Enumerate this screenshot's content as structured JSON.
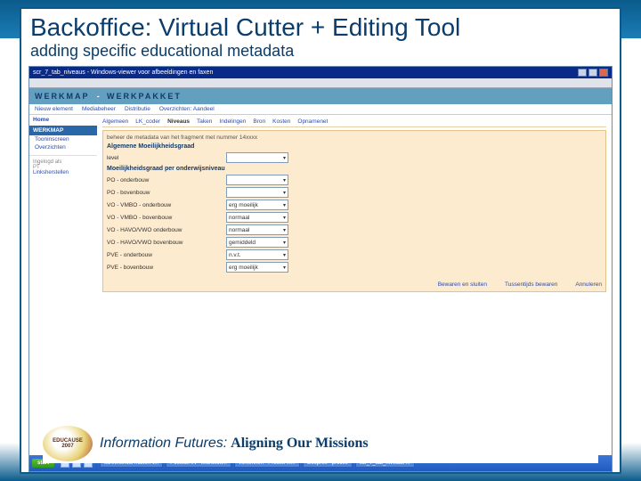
{
  "slide": {
    "title": "Backoffice: Virtual Cutter + Editing Tool",
    "subtitle": "adding specific educational metadata"
  },
  "window": {
    "title": "scr_7_tab_niveaus - Windows-viewer voor afbeeldingen en faxen"
  },
  "app": {
    "header1": "WERKMAP",
    "sep": "-",
    "header2": "WERKPAKKET",
    "topnav": [
      "Nieuw element",
      "Mediabeheer",
      "Distributie",
      "Overzichten: Aandeel"
    ]
  },
  "sidebar": {
    "home": "Home",
    "section": "WERKMAP",
    "links": [
      "Tooninscreen",
      "Overzichten"
    ],
    "logged_label": "Ingelogd als",
    "logged_user": "PT",
    "links2": "Linksherstellen"
  },
  "tabs": [
    "Algemeen",
    "LK_coder",
    "Niveaus",
    "Taken",
    "Indelingen",
    "Bron",
    "Kosten",
    "Opnamenet"
  ],
  "tabs_active": 2,
  "panel": {
    "desc": "beheer de metadata van het fragment met nummer 14xxxx",
    "section1": "Algemene Moeilijkheidsgraad",
    "row_level_label": "level",
    "row_level_value": "",
    "section2": "Moeilijkheidsgraad per onderwijsniveau",
    "rows": [
      {
        "label": "PO - onderbouw",
        "value": ""
      },
      {
        "label": "PO - bovenbouw",
        "value": ""
      },
      {
        "label": "VO - VMBO - onderbouw",
        "value": "erg moeilijk"
      },
      {
        "label": "VO - VMBO - bovenbouw",
        "value": "normaal"
      },
      {
        "label": "VO - HAVO/VWO onderbouw",
        "value": "normaal"
      },
      {
        "label": "VO - HAVO/VWO bovenbouw",
        "value": "gemiddeld"
      },
      {
        "label": "PVE - onderbouw",
        "value": "n.v.t."
      },
      {
        "label": "PVE - bovenbouw",
        "value": "erg moeilijk"
      }
    ],
    "actions": [
      "Bewaren en sluiten",
      "Tussentijds bewaren",
      "Annuleren"
    ]
  },
  "taskbar": {
    "start": "start",
    "items": [
      "screenshots maken v...",
      "Postvak IN - Microsoft...",
      "verkennen - Proces m...",
      "Gesprek - proces",
      "scr_7_tab_niveaus ..."
    ]
  },
  "footer": {
    "badge_org": "EDUCAUSE",
    "badge_year": "2007",
    "text_italic": "Information Futures:",
    "text_bold": "Aligning Our Missions"
  }
}
